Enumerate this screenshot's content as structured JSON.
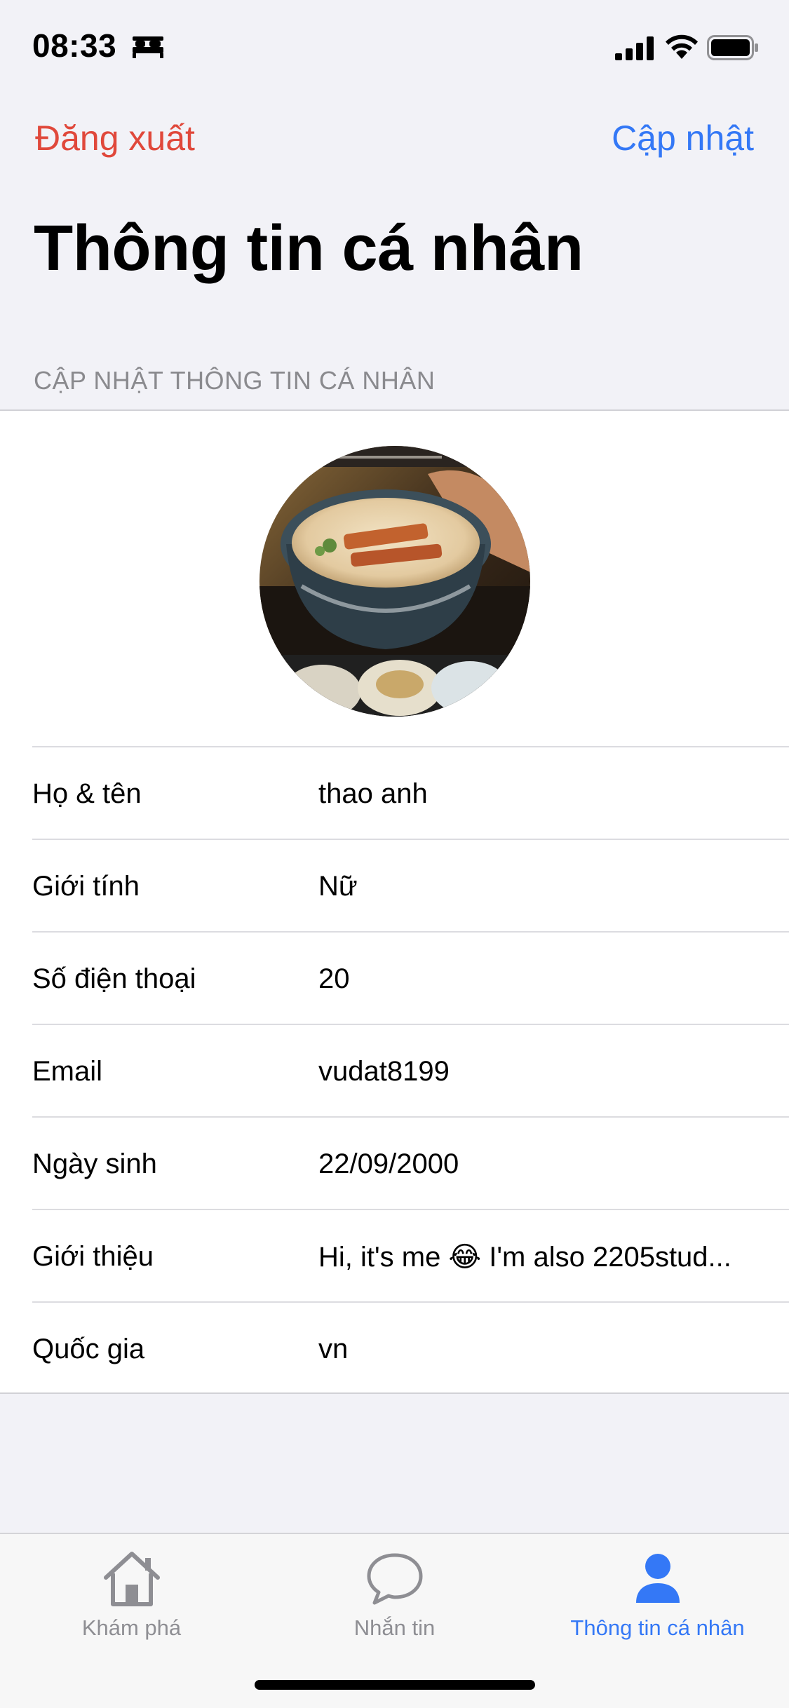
{
  "status_bar": {
    "time": "08:33",
    "icons": [
      "bed-icon",
      "signal-icon",
      "wifi-icon",
      "battery-icon"
    ]
  },
  "nav": {
    "left_label": "Đăng xuất",
    "right_label": "Cập nhật"
  },
  "page_title": "Thông tin cá nhân",
  "section_header": "CẬP NHẬT THÔNG TIN CÁ NHÂN",
  "profile_fields": [
    {
      "label": "Họ & tên",
      "value": "thao anh"
    },
    {
      "label": "Giới tính",
      "value": "Nữ"
    },
    {
      "label": "Số điện thoại",
      "value": "20"
    },
    {
      "label": "Email",
      "value": "vudat8199"
    },
    {
      "label": "Ngày sinh",
      "value": "22/09/2000"
    },
    {
      "label": "Giới thiệu",
      "value": "Hi, it's me 😂 I'm also 2205stud..."
    },
    {
      "label": "Quốc gia",
      "value": "vn"
    }
  ],
  "tab_bar": {
    "tabs": [
      {
        "label": "Khám phá",
        "icon": "house-icon",
        "active": false
      },
      {
        "label": "Nhắn tin",
        "icon": "chat-bubble-icon",
        "active": false
      },
      {
        "label": "Thông tin cá nhân",
        "icon": "person-icon",
        "active": true
      }
    ]
  },
  "colors": {
    "destructive": "#e0483b",
    "accent": "#3478f6",
    "inactive_tab": "#8e8e93",
    "background": "#f2f2f7"
  }
}
